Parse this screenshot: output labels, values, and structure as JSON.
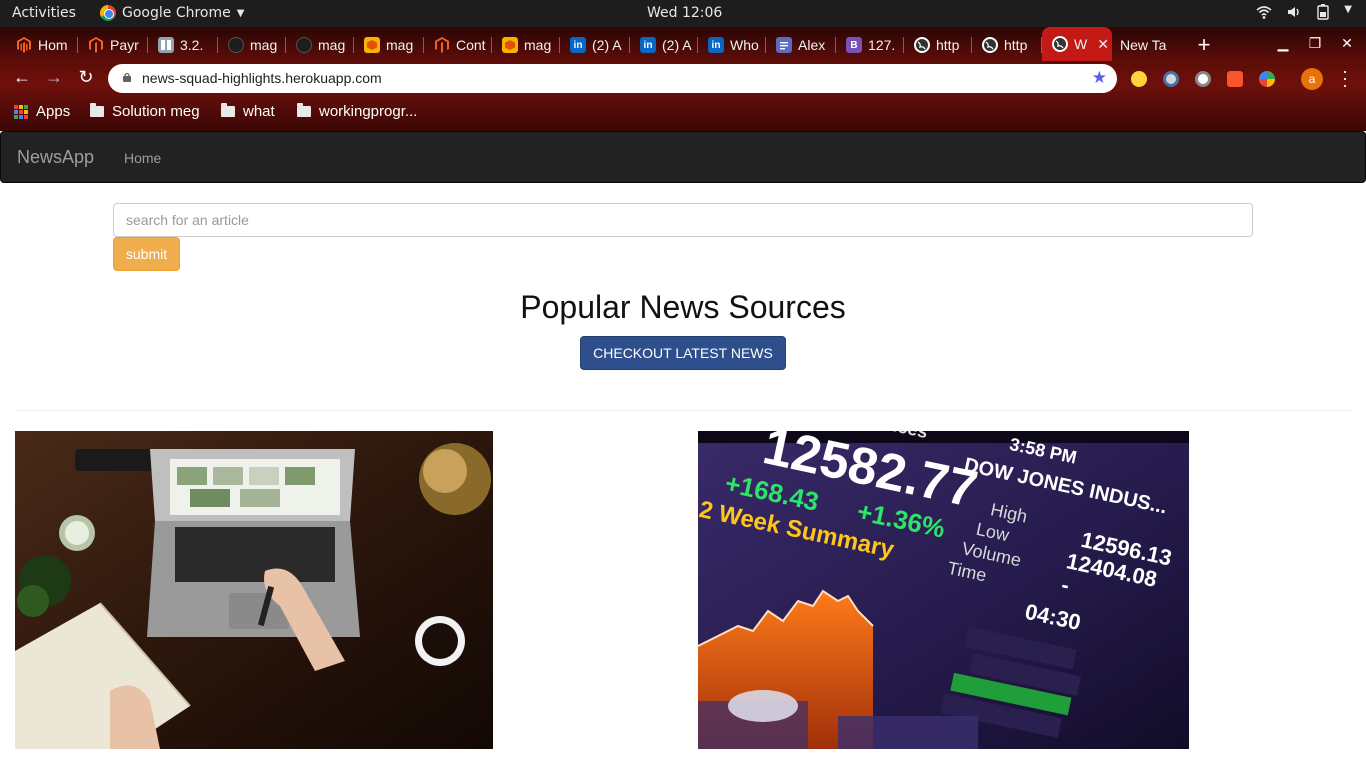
{
  "system_bar": {
    "activities": "Activities",
    "app_name": "Google Chrome",
    "clock": "Wed 12:06"
  },
  "browser": {
    "tabs": [
      {
        "label": "Hom",
        "icon": "magento-icon",
        "color": "#f26322"
      },
      {
        "label": "Payr",
        "icon": "magento-icon",
        "color": "#f26322"
      },
      {
        "label": "3.2.",
        "icon": "document-icon",
        "color": "#cfd8dc"
      },
      {
        "label": "mag",
        "icon": "github-icon",
        "color": "#333333"
      },
      {
        "label": "mag",
        "icon": "github-icon",
        "color": "#333333"
      },
      {
        "label": "mag",
        "icon": "box-icon",
        "color": "#f4b400"
      },
      {
        "label": "Cont",
        "icon": "magento-icon",
        "color": "#f26322"
      },
      {
        "label": "mag",
        "icon": "box-icon",
        "color": "#f4b400"
      },
      {
        "label": "(2) A",
        "icon": "linkedin-icon",
        "color": "#0a66c2"
      },
      {
        "label": "(2) A",
        "icon": "linkedin-icon",
        "color": "#0a66c2"
      },
      {
        "label": "Who",
        "icon": "linkedin-icon",
        "color": "#0a66c2"
      },
      {
        "label": "Alex",
        "icon": "docs-icon",
        "color": "#5c6bc0"
      },
      {
        "label": "127.",
        "icon": "bootstrap-icon",
        "color": "#7952b3"
      },
      {
        "label": "http",
        "icon": "globe-icon",
        "color": "#ffffff"
      },
      {
        "label": "http",
        "icon": "globe-icon",
        "color": "#ffffff"
      },
      {
        "label": "W",
        "icon": "globe-icon",
        "color": "#ffffff",
        "active": true
      },
      {
        "label": "New Ta",
        "icon": "",
        "color": ""
      }
    ],
    "url": "news-squad-highlights.herokuapp.com",
    "profile_initial": "a",
    "bookmarks": {
      "apps": "Apps",
      "folders": [
        "Solution meg",
        "what",
        "workingprogr..."
      ]
    }
  },
  "page": {
    "navbar": {
      "brand": "NewsApp",
      "home": "Home"
    },
    "search": {
      "placeholder": "search for an article",
      "submit_label": "submit"
    },
    "heading": "Popular News Sources",
    "latest_button": "CHECKOUT LATEST NEWS",
    "stock_image": {
      "index_label": "y Indices",
      "time": "3:58 PM",
      "ticker": "DOW JONES INDUS...",
      "value": "12582.77",
      "change": "+168.43",
      "change_pct": "+1.36%",
      "summary": "2 Week Summary",
      "high_label": "High",
      "low_label": "Low",
      "volume_label": "Volume",
      "time_label": "Time",
      "high_value": "12596.13",
      "low_value": "12404.08",
      "dash": "-",
      "time_value": "04:30"
    }
  },
  "colors": {
    "accent_warning": "#f0ad4e",
    "accent_primary": "#2e4f8c",
    "navbar_bg": "#222222"
  }
}
